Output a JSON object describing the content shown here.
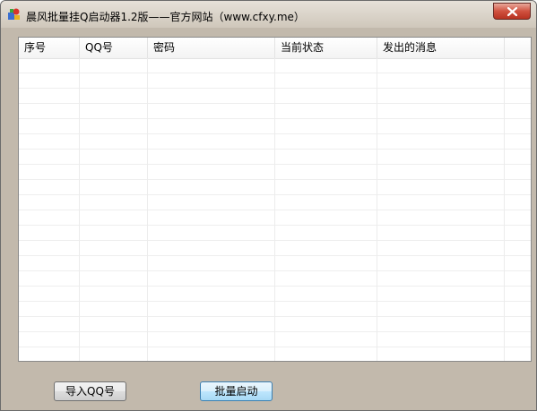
{
  "window": {
    "title": "晨风批量挂Q启动器1.2版——官方网站（www.cfxy.me）"
  },
  "table": {
    "columns": [
      "序号",
      "QQ号",
      "密码",
      "当前状态",
      "发出的消息"
    ],
    "rows": []
  },
  "buttons": {
    "import_label": "导入QQ号",
    "start_label": "批量启动"
  },
  "icons": {
    "app": "app-icon",
    "close": "close-icon"
  }
}
